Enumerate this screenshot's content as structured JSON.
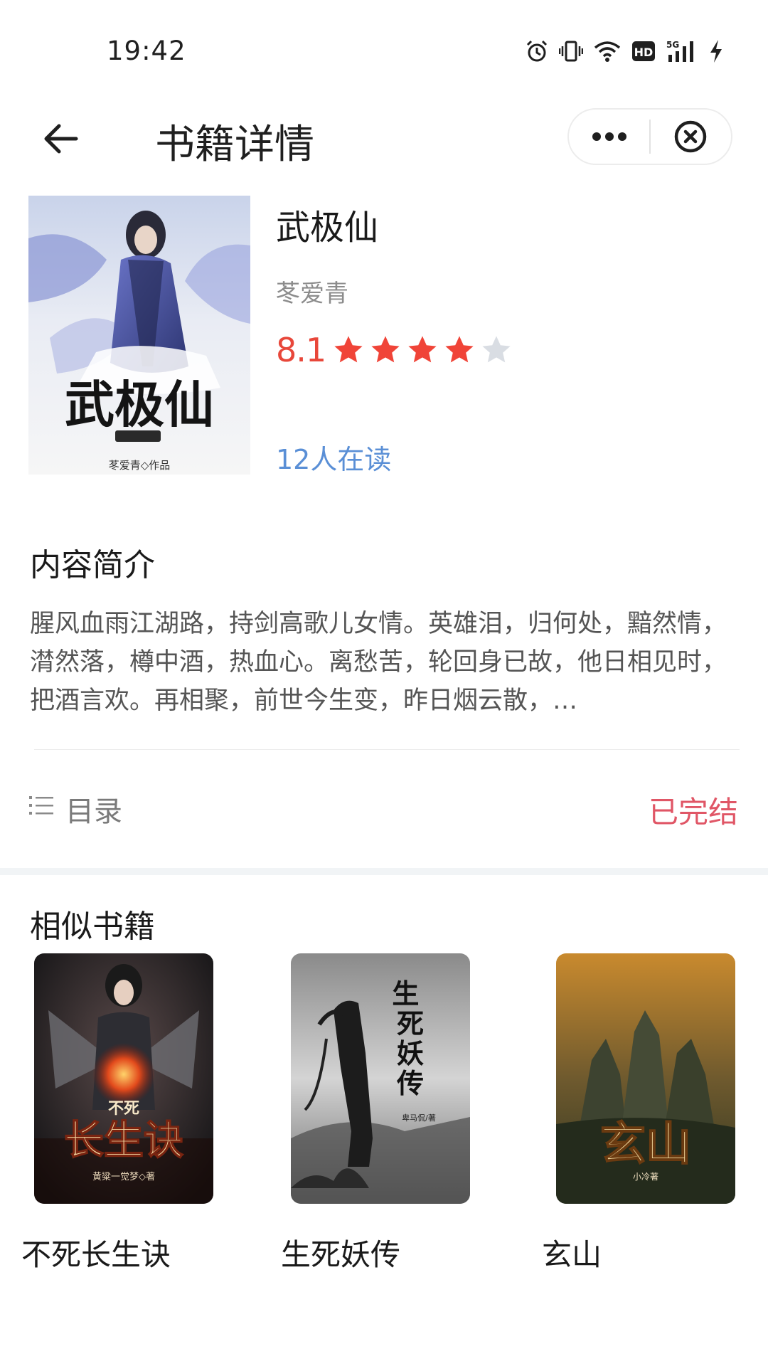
{
  "status_bar": {
    "time": "19:42",
    "icons": [
      "alarm-icon",
      "vibrate-icon",
      "wifi-icon",
      "hd-icon",
      "5g-signal-icon",
      "charging-icon"
    ],
    "hd_label": "HD",
    "network_label": "5G"
  },
  "header": {
    "title": "书籍详情",
    "back_icon": "arrow-left-icon",
    "more_icon": "more-dots-icon",
    "close_icon": "close-circle-icon"
  },
  "book": {
    "title": "武极仙",
    "author": "苳爱青",
    "rating": "8.1",
    "rating_fraction": 0.81,
    "stars_filled": 4,
    "stars_total": 5,
    "readers": "12人在读",
    "cover_text": "武极仙",
    "cover_credit": "苳爱青◇作品"
  },
  "intro": {
    "heading": "内容简介",
    "text": "腥风血雨江湖路，持剑高歌儿女情。英雄泪，归何处，黯然情，潸然落，樽中酒，热血心。离愁苦，轮回身已故，他日相见时，把酒言欢。再相聚，前世今生变，昨日烟云散，…"
  },
  "toc": {
    "label": "目录",
    "icon": "list-icon",
    "status": "已完结"
  },
  "similar": {
    "heading": "相似书籍",
    "books": [
      {
        "name": "不死长生诀",
        "cover_text": "长生诀",
        "cover_tag": "不死",
        "cover_credit": "黄粱一觉梦◇著"
      },
      {
        "name": "生死妖传",
        "cover_text": "生死妖传",
        "cover_credit": "卑马侃/著"
      },
      {
        "name": "玄山",
        "cover_text": "玄山",
        "cover_credit": "小冷著"
      }
    ]
  },
  "colors": {
    "rating": "#e8473a",
    "star_filled": "#f04438",
    "star_empty": "#d9dde3",
    "readers": "#5a8fd6",
    "finished": "#e05666",
    "section_bg": "#f1f4f6"
  }
}
